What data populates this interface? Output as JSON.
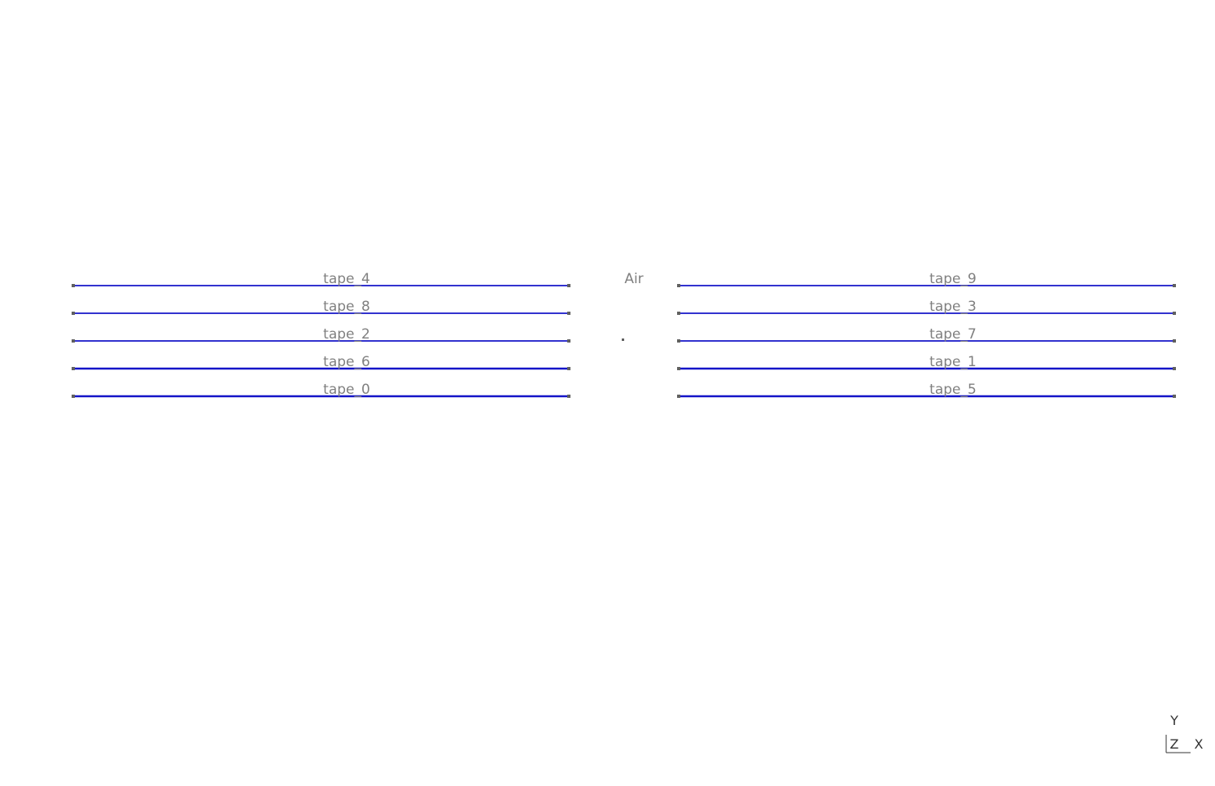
{
  "viewport": {
    "region_label": "Air",
    "line_color": "#1414c8",
    "endpoint_color": "#606060",
    "label_color": "#808080",
    "background": "#ffffff"
  },
  "tape_rows": [
    {
      "left": "tape_4",
      "right": "tape_9"
    },
    {
      "left": "tape_8",
      "right": "tape_3"
    },
    {
      "left": "tape_2",
      "right": "tape_7"
    },
    {
      "left": "tape_6",
      "right": "tape_1"
    },
    {
      "left": "tape_0",
      "right": "tape_5"
    }
  ],
  "axis_triad": {
    "y_label": "Y",
    "z_label": "Z",
    "x_label": "X"
  }
}
